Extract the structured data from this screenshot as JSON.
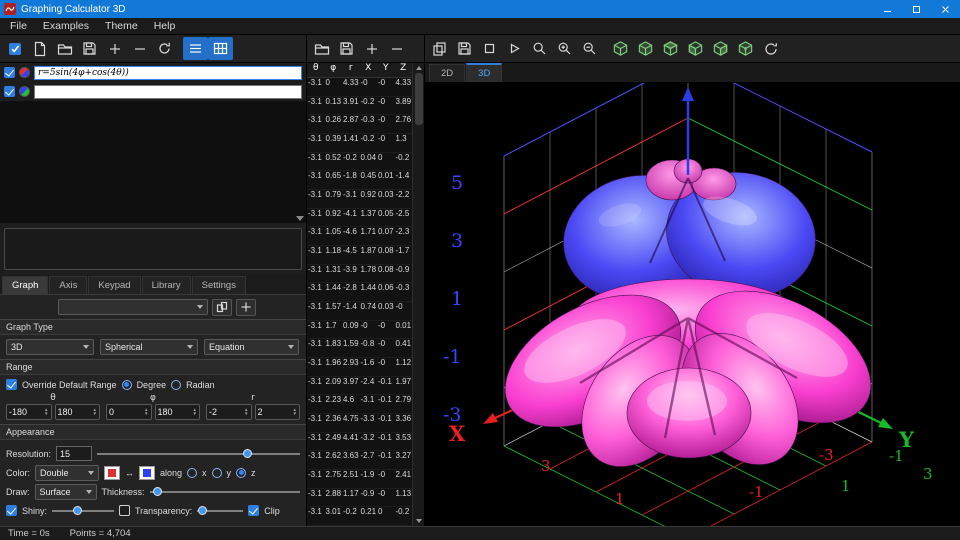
{
  "titlebar": {
    "title": "Graphing Calculator 3D"
  },
  "menubar": {
    "items": [
      "File",
      "Examples",
      "Theme",
      "Help"
    ]
  },
  "main_toolbar": {
    "icons": [
      "select-check",
      "new-file",
      "open-folder",
      "save",
      "add-equation",
      "remove-equation",
      "refresh",
      "equations-panel-toggle",
      "table-panel-toggle"
    ]
  },
  "table_toolbar": {
    "icons": [
      "open-folder",
      "save",
      "add-row",
      "remove-row"
    ]
  },
  "plot_toolbar": {
    "icons": [
      "copy",
      "save-image",
      "stop",
      "play",
      "zoom",
      "zoom-in",
      "zoom-out",
      "view-cube-1",
      "view-cube-2",
      "view-cube-3",
      "view-cube-4",
      "view-cube-5",
      "view-cube-6",
      "rotate-view"
    ]
  },
  "equations": {
    "rows": [
      {
        "expression": "r=5sin(4φ+cos(4θ))",
        "colors": [
          "#e03030",
          "#3040ff"
        ],
        "checked": true
      },
      {
        "expression": "",
        "colors": [
          "#3040ff",
          "#25c030"
        ],
        "checked": true
      }
    ]
  },
  "tabs": {
    "items": [
      "Graph",
      "Axis",
      "Keypad",
      "Library",
      "Settings"
    ],
    "active": "Graph"
  },
  "selector_row": {
    "preset_value": ""
  },
  "graph_type": {
    "title": "Graph Type",
    "dimension": "3D",
    "system": "Spherical",
    "mode": "Equation"
  },
  "range": {
    "title": "Range",
    "override_label": "Override Default Range",
    "degree_label": "Degree",
    "radian_label": "Radian",
    "vars": [
      {
        "name": "θ",
        "min": "-180",
        "max": "180"
      },
      {
        "name": "φ",
        "min": "0",
        "max": "180"
      },
      {
        "name": "r",
        "min": "-2",
        "max": "2"
      }
    ]
  },
  "appearance": {
    "title": "Appearance",
    "resolution_label": "Resolution:",
    "resolution_value": "15",
    "color_label": "Color:",
    "color_mode": "Double",
    "swap_symbol": "↔",
    "along_label": "along",
    "axes": [
      "x",
      "y",
      "z"
    ],
    "along_selected": "z",
    "color_swatches": [
      "#e03030",
      "#3040ff"
    ],
    "draw_label": "Draw:",
    "draw_mode": "Surface",
    "thickness_label": "Thickness:",
    "shiny_label": "Shiny:",
    "transparency_label": "Transparency:",
    "clip_label": "Clip"
  },
  "table": {
    "headers": [
      "θ",
      "φ",
      "r",
      "X",
      "Y",
      "Z"
    ],
    "rows": [
      [
        "-3.1",
        "0",
        "4.33",
        "-0",
        "-0",
        "4.33"
      ],
      [
        "-3.1",
        "0.13",
        "3.91",
        "-0.2",
        "-0",
        "3.89"
      ],
      [
        "-3.1",
        "0.26",
        "2.87",
        "-0.3",
        "-0",
        "2.76"
      ],
      [
        "-3.1",
        "0.39",
        "1.41",
        "-0.2",
        "-0",
        "1.3"
      ],
      [
        "-3.1",
        "0.52",
        "-0.2",
        "0.04",
        "0",
        "-0.2"
      ],
      [
        "-3.1",
        "0.65",
        "-1.8",
        "0.45",
        "0.01",
        "-1.4"
      ],
      [
        "-3.1",
        "0.79",
        "-3.1",
        "0.92",
        "0.03",
        "-2.2"
      ],
      [
        "-3.1",
        "0.92",
        "-4.1",
        "1.37",
        "0.05",
        "-2.5"
      ],
      [
        "-3.1",
        "1.05",
        "-4.6",
        "1.71",
        "0.07",
        "-2.3"
      ],
      [
        "-3.1",
        "1.18",
        "-4.5",
        "1.87",
        "0.08",
        "-1.7"
      ],
      [
        "-3.1",
        "1.31",
        "-3.9",
        "1.78",
        "0.08",
        "-0.9"
      ],
      [
        "-3.1",
        "1.44",
        "-2.8",
        "1.44",
        "0.06",
        "-0.3"
      ],
      [
        "-3.1",
        "1.57",
        "-1.4",
        "0.74",
        "0.03",
        "-0"
      ],
      [
        "-3.1",
        "1.7",
        "0.09",
        "-0",
        "-0",
        "0.01"
      ],
      [
        "-3.1",
        "1.83",
        "1.59",
        "-0.8",
        "-0",
        "0.41"
      ],
      [
        "-3.1",
        "1.96",
        "2.93",
        "-1.6",
        "-0",
        "1.12"
      ],
      [
        "-3.1",
        "2.09",
        "3.97",
        "-2.4",
        "-0.1",
        "1.97"
      ],
      [
        "-3.1",
        "2.23",
        "4.6",
        "-3.1",
        "-0.1",
        "2.79"
      ],
      [
        "-3.1",
        "2.36",
        "4.75",
        "-3.3",
        "-0.1",
        "3.36"
      ],
      [
        "-3.1",
        "2.49",
        "4.41",
        "-3.2",
        "-0.1",
        "3.53"
      ],
      [
        "-3.1",
        "2.62",
        "3.63",
        "-2.7",
        "-0.1",
        "3.27"
      ],
      [
        "-3.1",
        "2.75",
        "2.51",
        "-1.9",
        "-0",
        "2.41"
      ],
      [
        "-3.1",
        "2.88",
        "1.17",
        "-0.9",
        "-0",
        "1.13"
      ],
      [
        "-3.1",
        "3.01",
        "-0.2",
        "0.21",
        "0",
        "-0.2"
      ]
    ]
  },
  "view_tabs": {
    "items": [
      "2D",
      "3D"
    ],
    "active": "3D"
  },
  "plot": {
    "x_label": "X",
    "y_label": "Y",
    "z_ticks": [
      "5",
      "3",
      "1",
      "-1",
      "-3"
    ],
    "x_ticks": [
      "3",
      "1",
      "-1",
      "-3"
    ],
    "y_ticks": [
      "1",
      "3",
      "-1"
    ],
    "colors": {
      "x_axis": "#e81f1f",
      "y_axis": "#16b926",
      "z_axis": "#2a3ee8",
      "surface_top": "#4b49f5",
      "surface_bottom": "#fa3fd0"
    }
  },
  "statusbar": {
    "time": "Time = 0s",
    "points": "Points = 4,704"
  }
}
